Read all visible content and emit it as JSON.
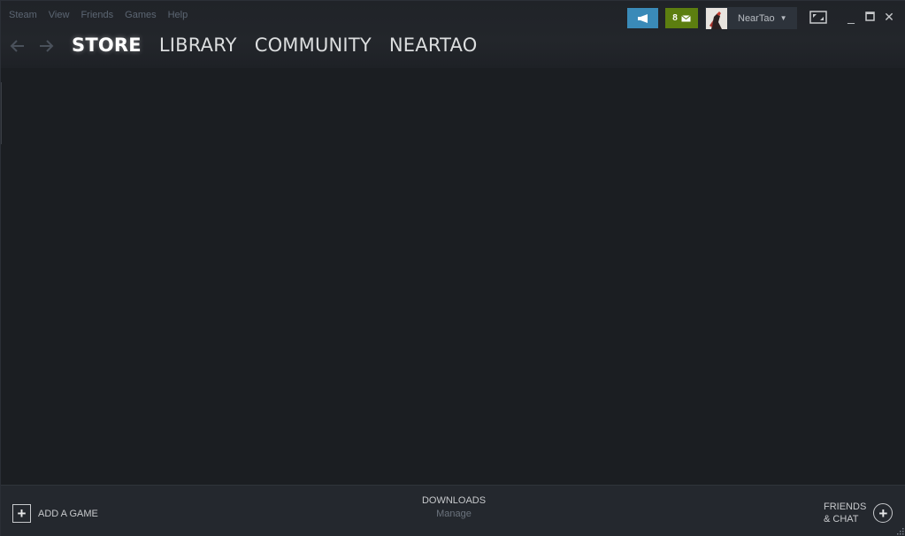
{
  "menubar": {
    "items": [
      "Steam",
      "View",
      "Friends",
      "Games",
      "Help"
    ]
  },
  "nav": {
    "back_icon": "arrow-left-icon",
    "forward_icon": "arrow-right-icon",
    "tabs": [
      {
        "label": "STORE",
        "active": true
      },
      {
        "label": "LIBRARY",
        "active": false
      },
      {
        "label": "COMMUNITY",
        "active": false
      },
      {
        "label": "NEARTAO",
        "active": false
      }
    ]
  },
  "header_right": {
    "announcement_icon": "megaphone-icon",
    "notification_count": "8",
    "notification_icon": "envelope-icon",
    "account_name": "NearTao",
    "bigpicture_icon": "big-picture-icon"
  },
  "window_controls": {
    "minimize": "_",
    "maximize": "☐",
    "close": "✕"
  },
  "footer": {
    "add_game_label": "ADD A GAME",
    "downloads_title": "DOWNLOADS",
    "downloads_sub": "Manage",
    "friends_line1": "FRIENDS",
    "friends_line2": "& CHAT"
  },
  "colors": {
    "announce_bg": "#3a8ab8",
    "notif_bg": "#5c7e10",
    "content_bg": "#1b1e22",
    "footer_bg": "#24282e"
  }
}
